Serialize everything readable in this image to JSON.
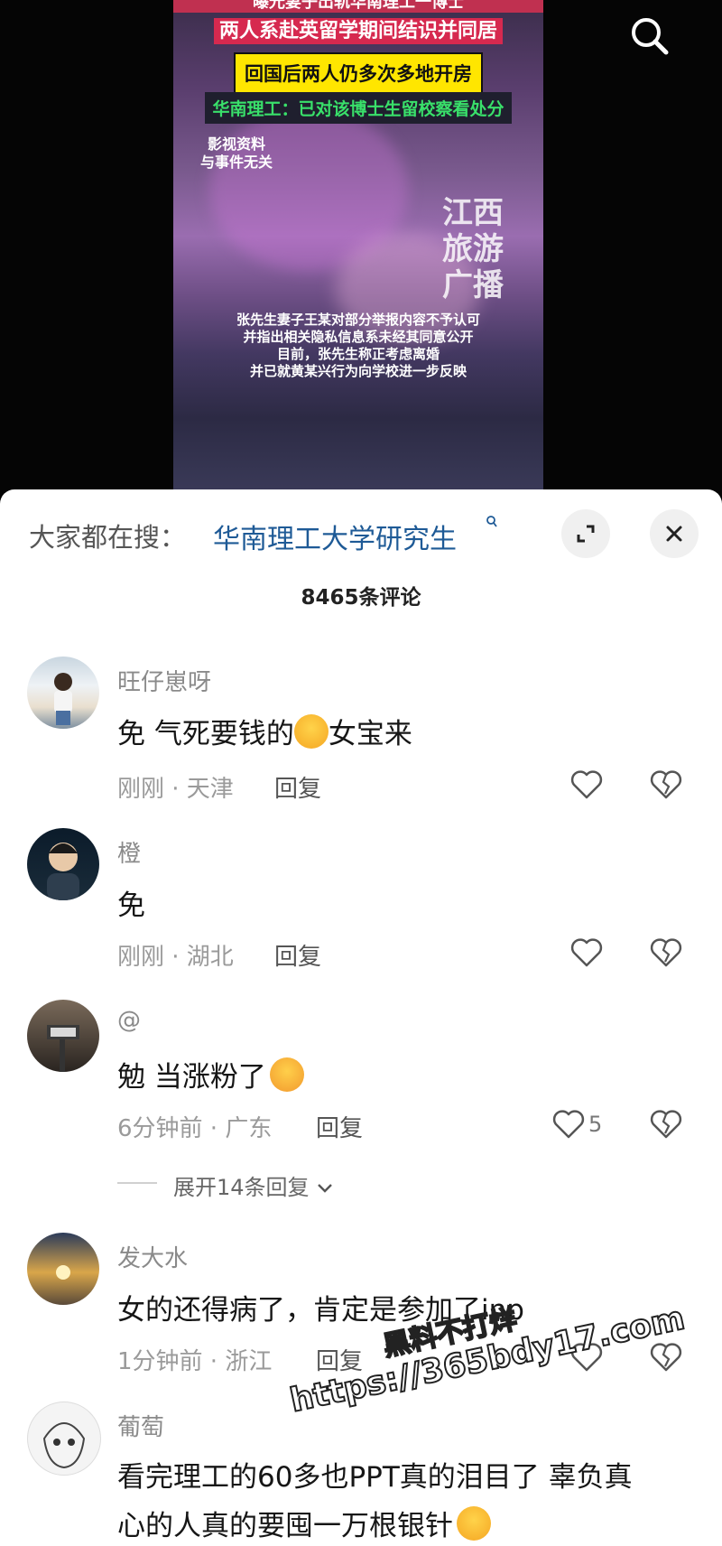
{
  "video": {
    "caption_top": "曝光妻子出轨华南理工一博士",
    "caption_red": "两人系赴英留学期间结识并同居",
    "caption_yellow": "回国后两人仍多次多地开房",
    "caption_green": "华南理工：已对该博士生留校察看处分",
    "note_line1": "影视资料",
    "note_line2": "与事件无关",
    "source_l1": "江西",
    "source_l2": "旅游",
    "source_l3": "广播",
    "bottom_l1": "张先生妻子王某对部分举报内容不予认可",
    "bottom_l2": "并指出相关隐私信息系未经其同意公开",
    "bottom_l3": "目前，张先生称正考虑离婚",
    "bottom_l4": "并已就黄某兴行为向学校进一步反映",
    "search_icon": "search-icon"
  },
  "sheet": {
    "trend_label": "大家都在搜：",
    "trend_query": "华南理工大学研究生",
    "comment_count": "8465条评论",
    "close_icon": "close-icon",
    "expand_icon": "expand-icon"
  },
  "comments": [
    {
      "user": "旺仔崽呀",
      "text_a": "免 气死要钱的",
      "text_b": "女宝来",
      "time": "刚刚 · 天津",
      "reply": "回复",
      "likes": ""
    },
    {
      "user": "橙",
      "text_a": "免",
      "text_b": "",
      "time": "刚刚 · 湖北",
      "reply": "回复",
      "likes": ""
    },
    {
      "user": "@",
      "text_a": "勉 当涨粉了",
      "text_b": "",
      "time": "6分钟前 · 广东",
      "reply": "回复",
      "likes": "5",
      "expand": "展开14条回复"
    },
    {
      "user": "发大水",
      "text_a": "女的还得病了，肯定是参加了inp",
      "text_b": "",
      "time": "1分钟前 · 浙江",
      "reply": "回复",
      "likes": ""
    },
    {
      "user": "葡萄",
      "text_a": "看完理工的60多也PPT真的泪目了 辜负真",
      "text_b": "心的人真的要囤一万根银针",
      "time": "",
      "reply": "",
      "likes": ""
    }
  ],
  "watermark": {
    "line1": "黑料不打烊",
    "line2": "https://365bdy17.com"
  }
}
